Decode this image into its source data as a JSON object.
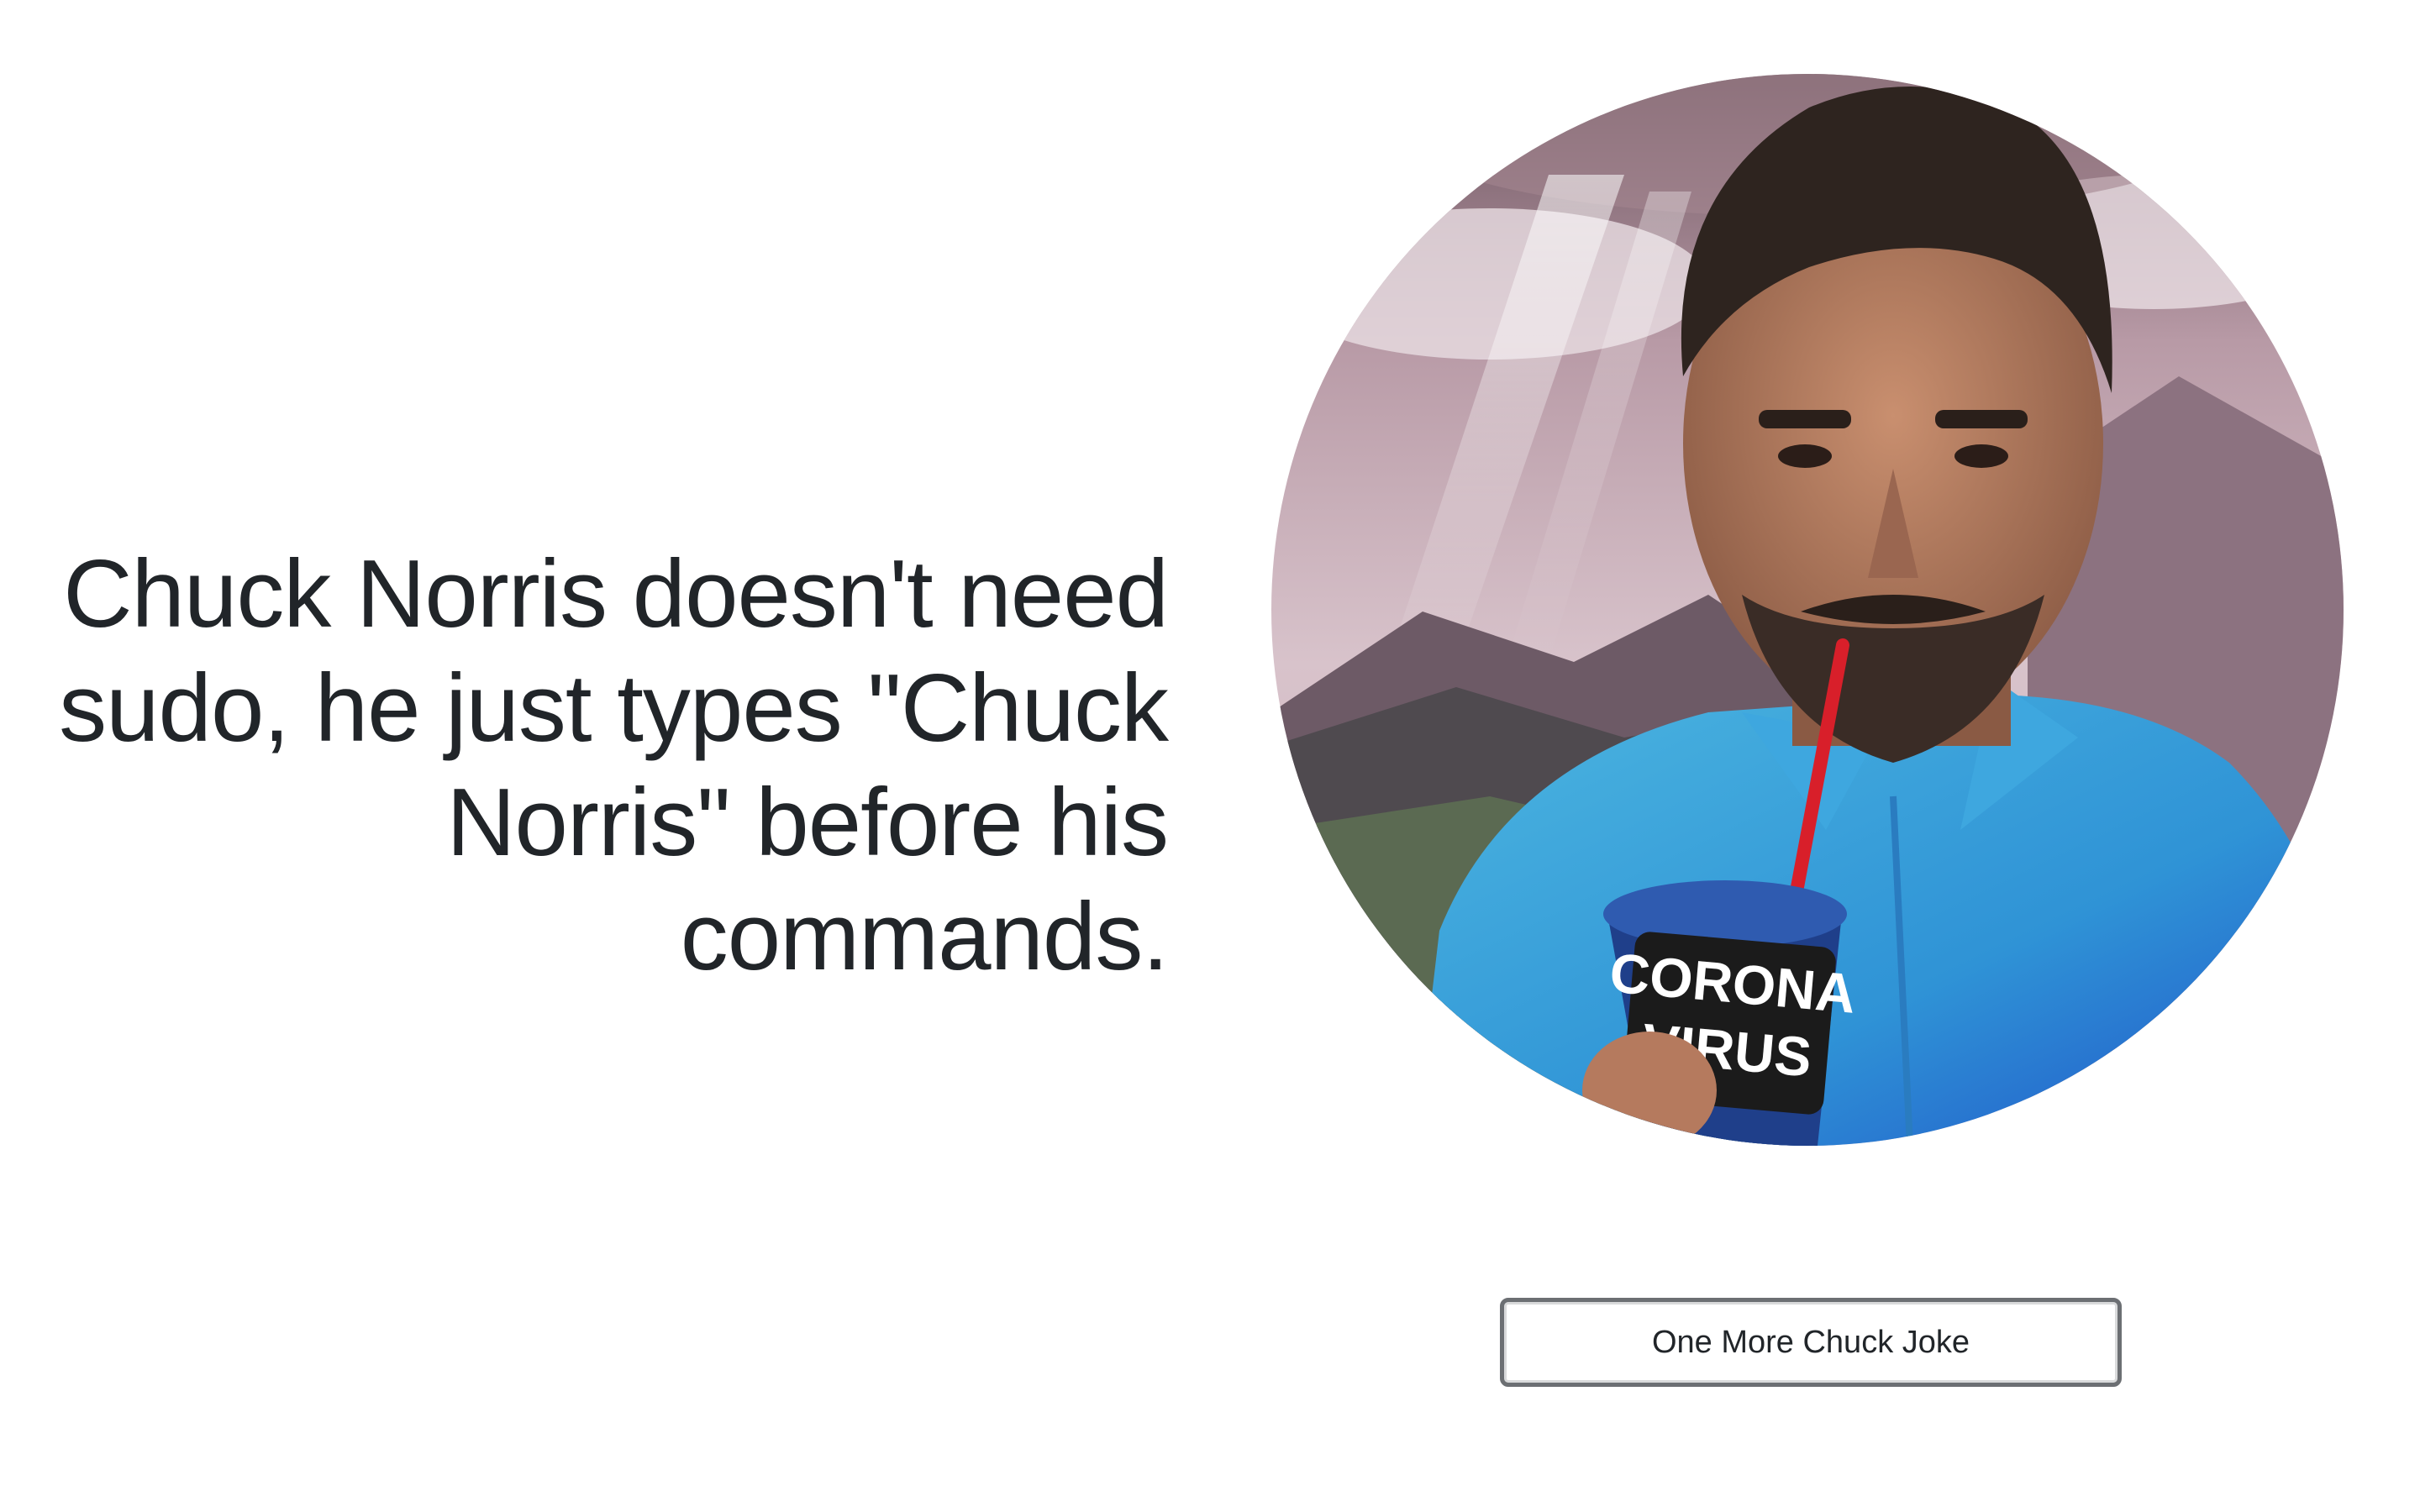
{
  "joke": {
    "text": "Chuck Norris doesn't need sudo, he just types \"Chuck Norris\" before his commands."
  },
  "portrait": {
    "cup_label_line1": "CORONA",
    "cup_label_line2": "VIRUS"
  },
  "actions": {
    "more_label": "One More Chuck Joke"
  }
}
